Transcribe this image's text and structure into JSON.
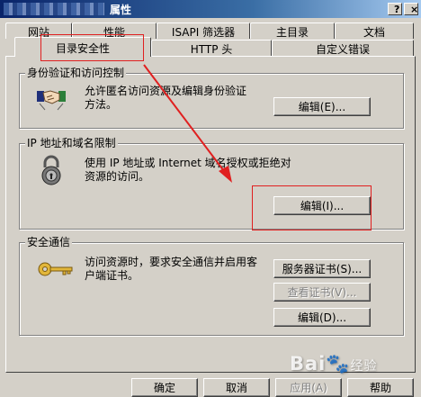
{
  "window": {
    "title": "属性",
    "help_button": "?",
    "close_button": "×"
  },
  "tabs": {
    "back_row": [
      "网站",
      "性能",
      "ISAPI 筛选器",
      "主目录",
      "文档"
    ],
    "front_row": [
      "目录安全性",
      "HTTP 头",
      "自定义错误"
    ],
    "active": "目录安全性"
  },
  "auth": {
    "label": "身份验证和访问控制",
    "desc": "允许匿名访问资源及编辑身份验证方法。",
    "edit_button": "编辑(E)..."
  },
  "ip": {
    "label": "IP 地址和域名限制",
    "desc": "使用 IP 地址或 Internet 域名授权或拒绝对资源的访问。",
    "edit_button": "编辑(I)..."
  },
  "secure": {
    "label": "安全通信",
    "desc": "访问资源时，要求安全通信并启用客户端证书。",
    "server_cert_button": "服务器证书(S)...",
    "view_cert_button": "查看证书(V)...",
    "edit_button": "编辑(D)..."
  },
  "footer": {
    "ok": "确定",
    "cancel": "取消",
    "apply": "应用(A)",
    "help": "帮助"
  },
  "watermark": {
    "text": "Bai",
    "suffix": "经验"
  },
  "icons": {
    "auth": "handshake-icon",
    "ip": "padlock-icon",
    "secure": "key-icon"
  },
  "colors": {
    "annotation": "#e02020",
    "titlebar": "#0a246a",
    "face": "#d4d0c8"
  }
}
